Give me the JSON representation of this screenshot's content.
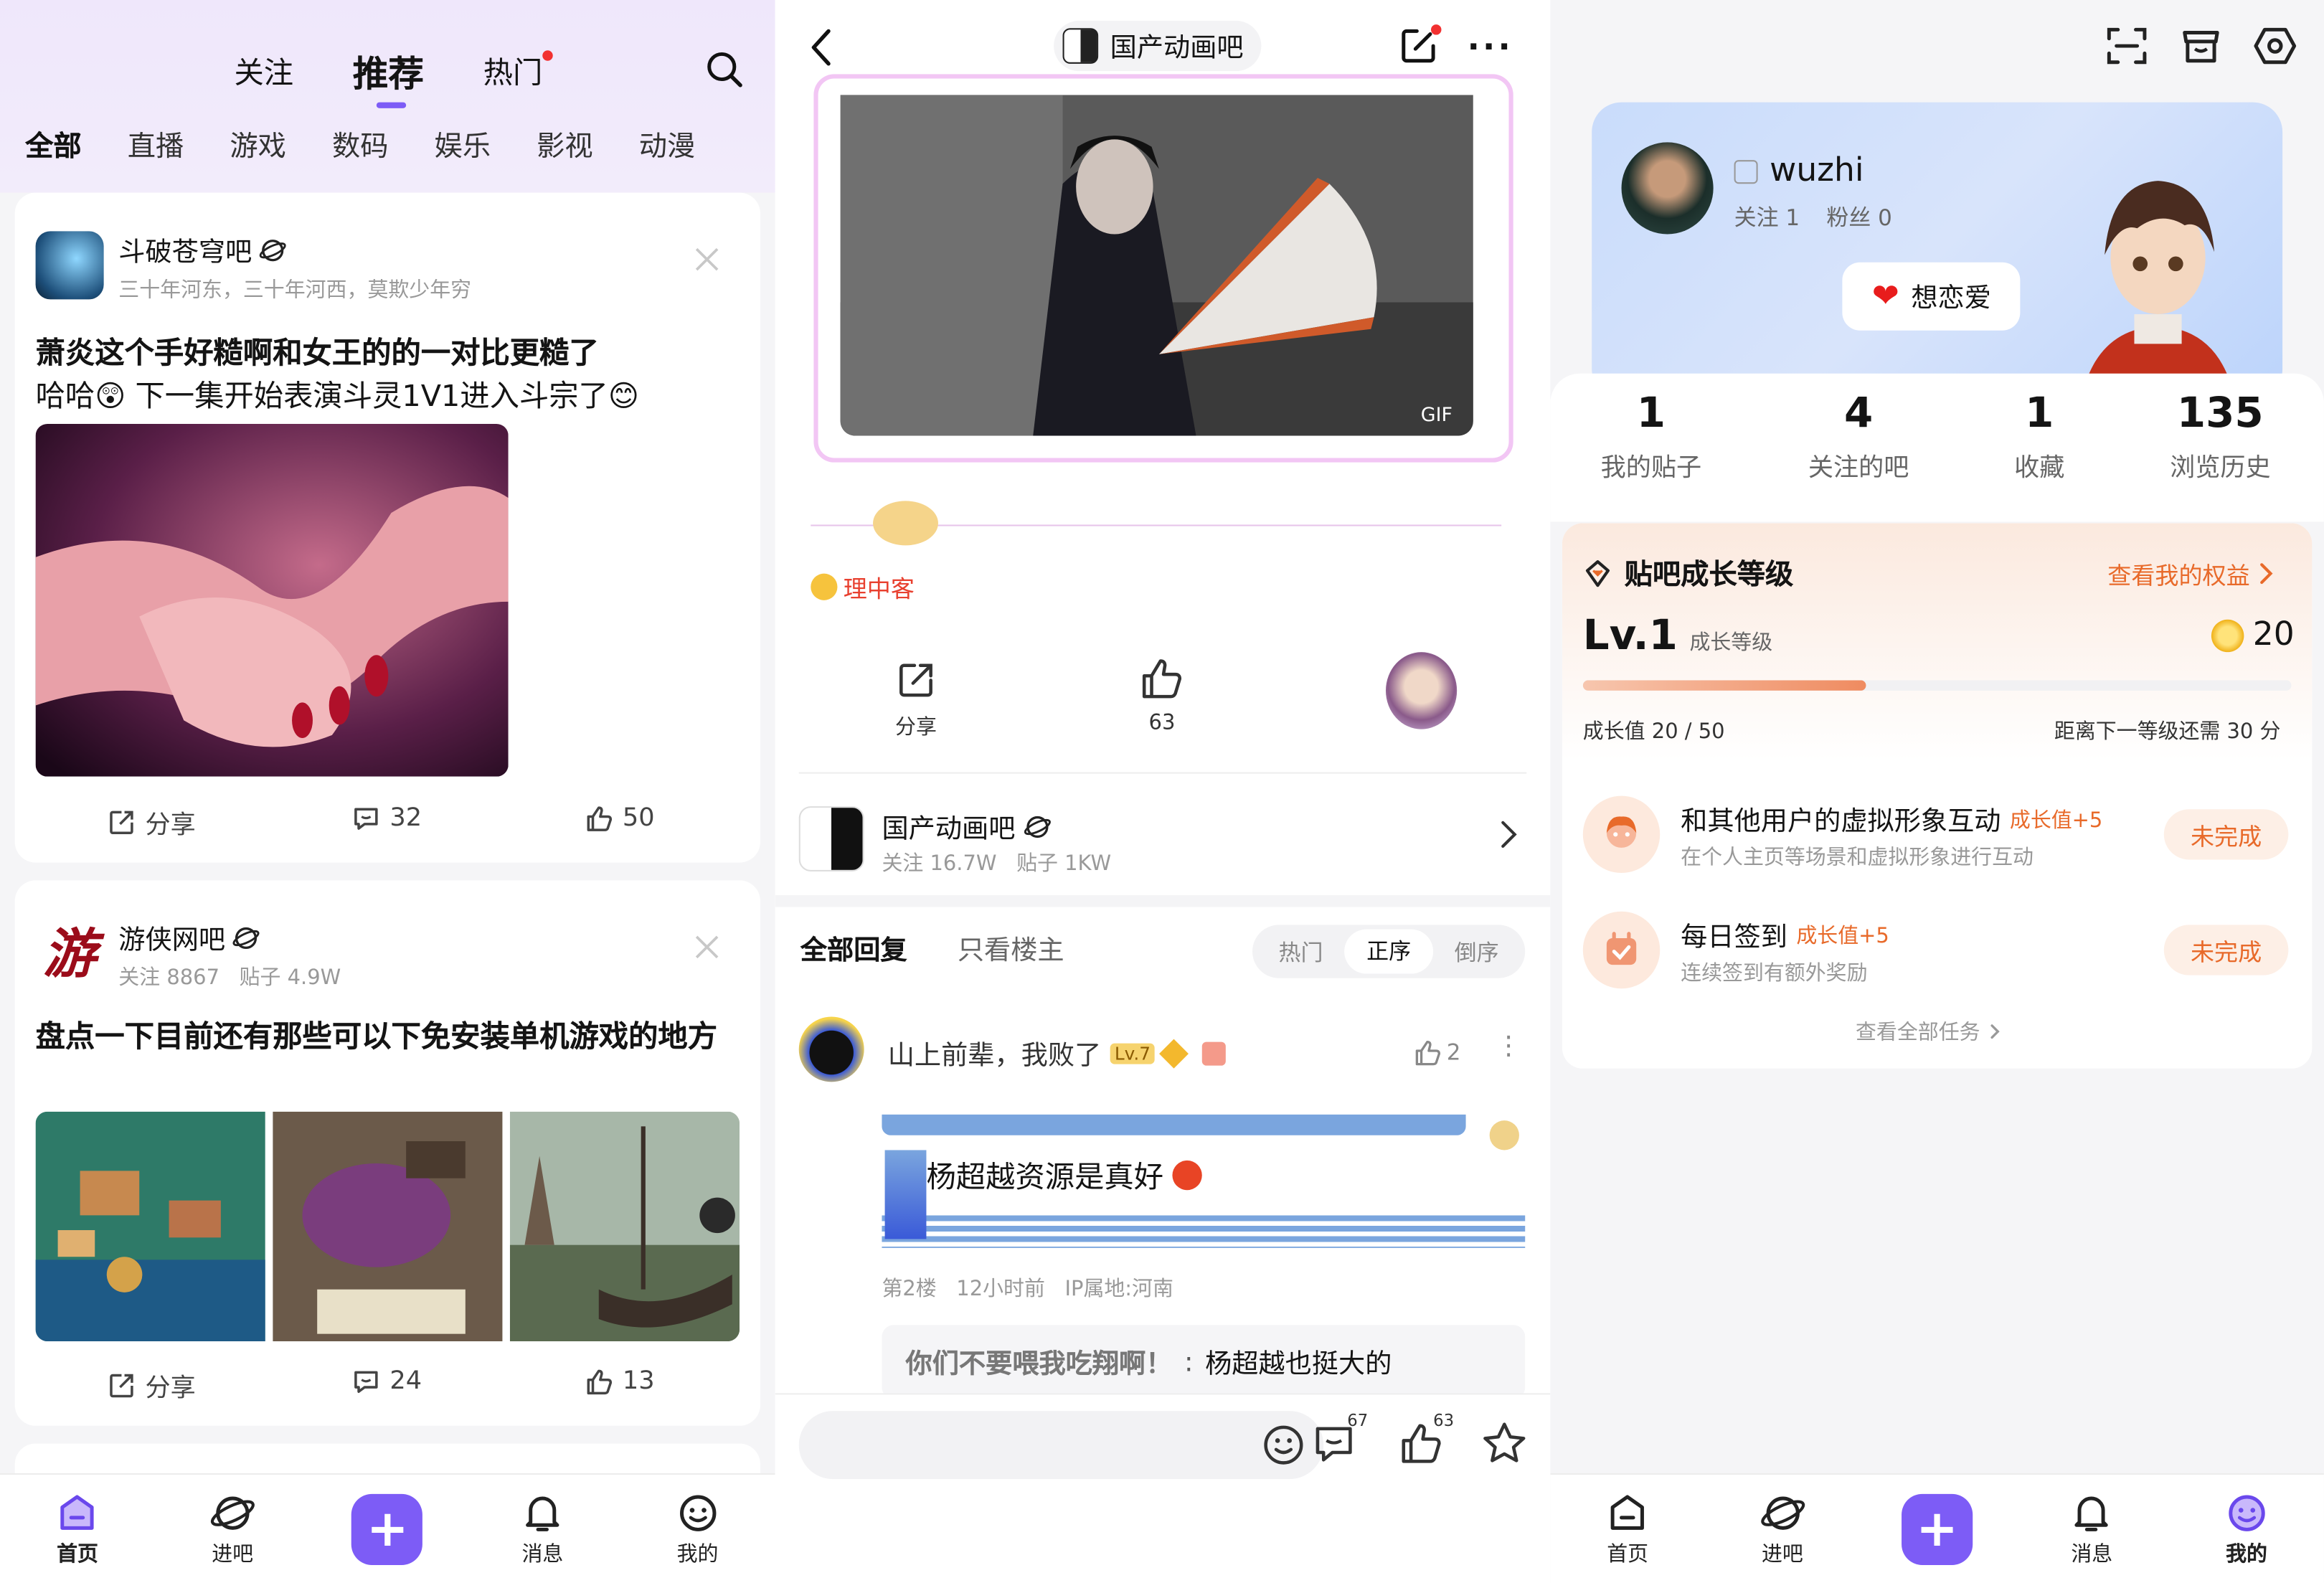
{
  "home": {
    "top_tabs": [
      "关注",
      "推荐",
      "热门"
    ],
    "categories": [
      "全部",
      "直播",
      "游戏",
      "数码",
      "娱乐",
      "影视",
      "动漫"
    ],
    "posts": [
      {
        "forum": "斗破苍穹吧",
        "subtitle": "三十年河东，三十年河西，莫欺少年穷",
        "title_line1": "萧炎这个手好糙啊和女王的的一对比更糙了",
        "title_line2": "哈哈😲 下一集开始表演斗灵1V1进入斗宗了😊",
        "share": "分享",
        "comments": "32",
        "likes": "50"
      },
      {
        "forum": "游侠网吧",
        "subtitle": "关注 8867   贴子 4.9W",
        "title": "盘点一下目前还有那些可以下免安装单机游戏的地方",
        "share": "分享",
        "comments": "24",
        "likes": "13"
      }
    ]
  },
  "tabbar": {
    "home": "首页",
    "enter": "进吧",
    "messages": "消息",
    "mine": "我的"
  },
  "thread": {
    "forum_name": "国产动画吧",
    "gif_badge": "GIF",
    "user_tag": "理中客",
    "share": "分享",
    "like_count": "63",
    "forum_card_name": "国产动画吧",
    "forum_card_stats": "关注 16.7W   贴子 1KW",
    "reply_tabs": [
      "全部回复",
      "只看楼主"
    ],
    "sort_options": [
      "热门",
      "正序",
      "倒序"
    ],
    "reply": {
      "user": "山上前辈，我败了",
      "level": "Lv.7",
      "like_count": "2",
      "content": "杨超越资源是真好",
      "meta": "第2楼   12小时前   IP属地:河南",
      "sub_reply_user": "你们不要喂我吃翔啊！",
      "sub_reply_text": "杨超越也挺大的"
    },
    "bottom": {
      "comment_count": "67",
      "like_count": "63"
    }
  },
  "profile": {
    "username": "wuzhi",
    "following": "关注 1",
    "fans": "粉丝 0",
    "mood": "想恋爱",
    "stats": [
      {
        "value": "1",
        "label": "我的贴子"
      },
      {
        "value": "4",
        "label": "关注的吧"
      },
      {
        "value": "1",
        "label": "收藏"
      },
      {
        "value": "135",
        "label": "浏览历史"
      }
    ],
    "growth": {
      "title": "贴吧成长等级",
      "link": "查看我的权益",
      "level": "Lv.1",
      "level_label": "成长等级",
      "coins": "20",
      "progress": 0.4,
      "progress_text": "成长值 20 / 50",
      "remaining_text": "距离下一等级还需 30 分",
      "tasks": [
        {
          "title": "和其他用户的虚拟形象互动",
          "reward": "成长值+5",
          "desc": "在个人主页等场景和虚拟形象进行互动",
          "status": "未完成"
        },
        {
          "title": "每日签到",
          "reward": "成长值+5",
          "desc": "连续签到有额外奖励",
          "status": "未完成"
        }
      ],
      "all_tasks": "查看全部任务"
    }
  },
  "colors": {
    "accent": "#7d5cf6",
    "orange": "#e86a2a",
    "red_dot": "#f23030"
  }
}
